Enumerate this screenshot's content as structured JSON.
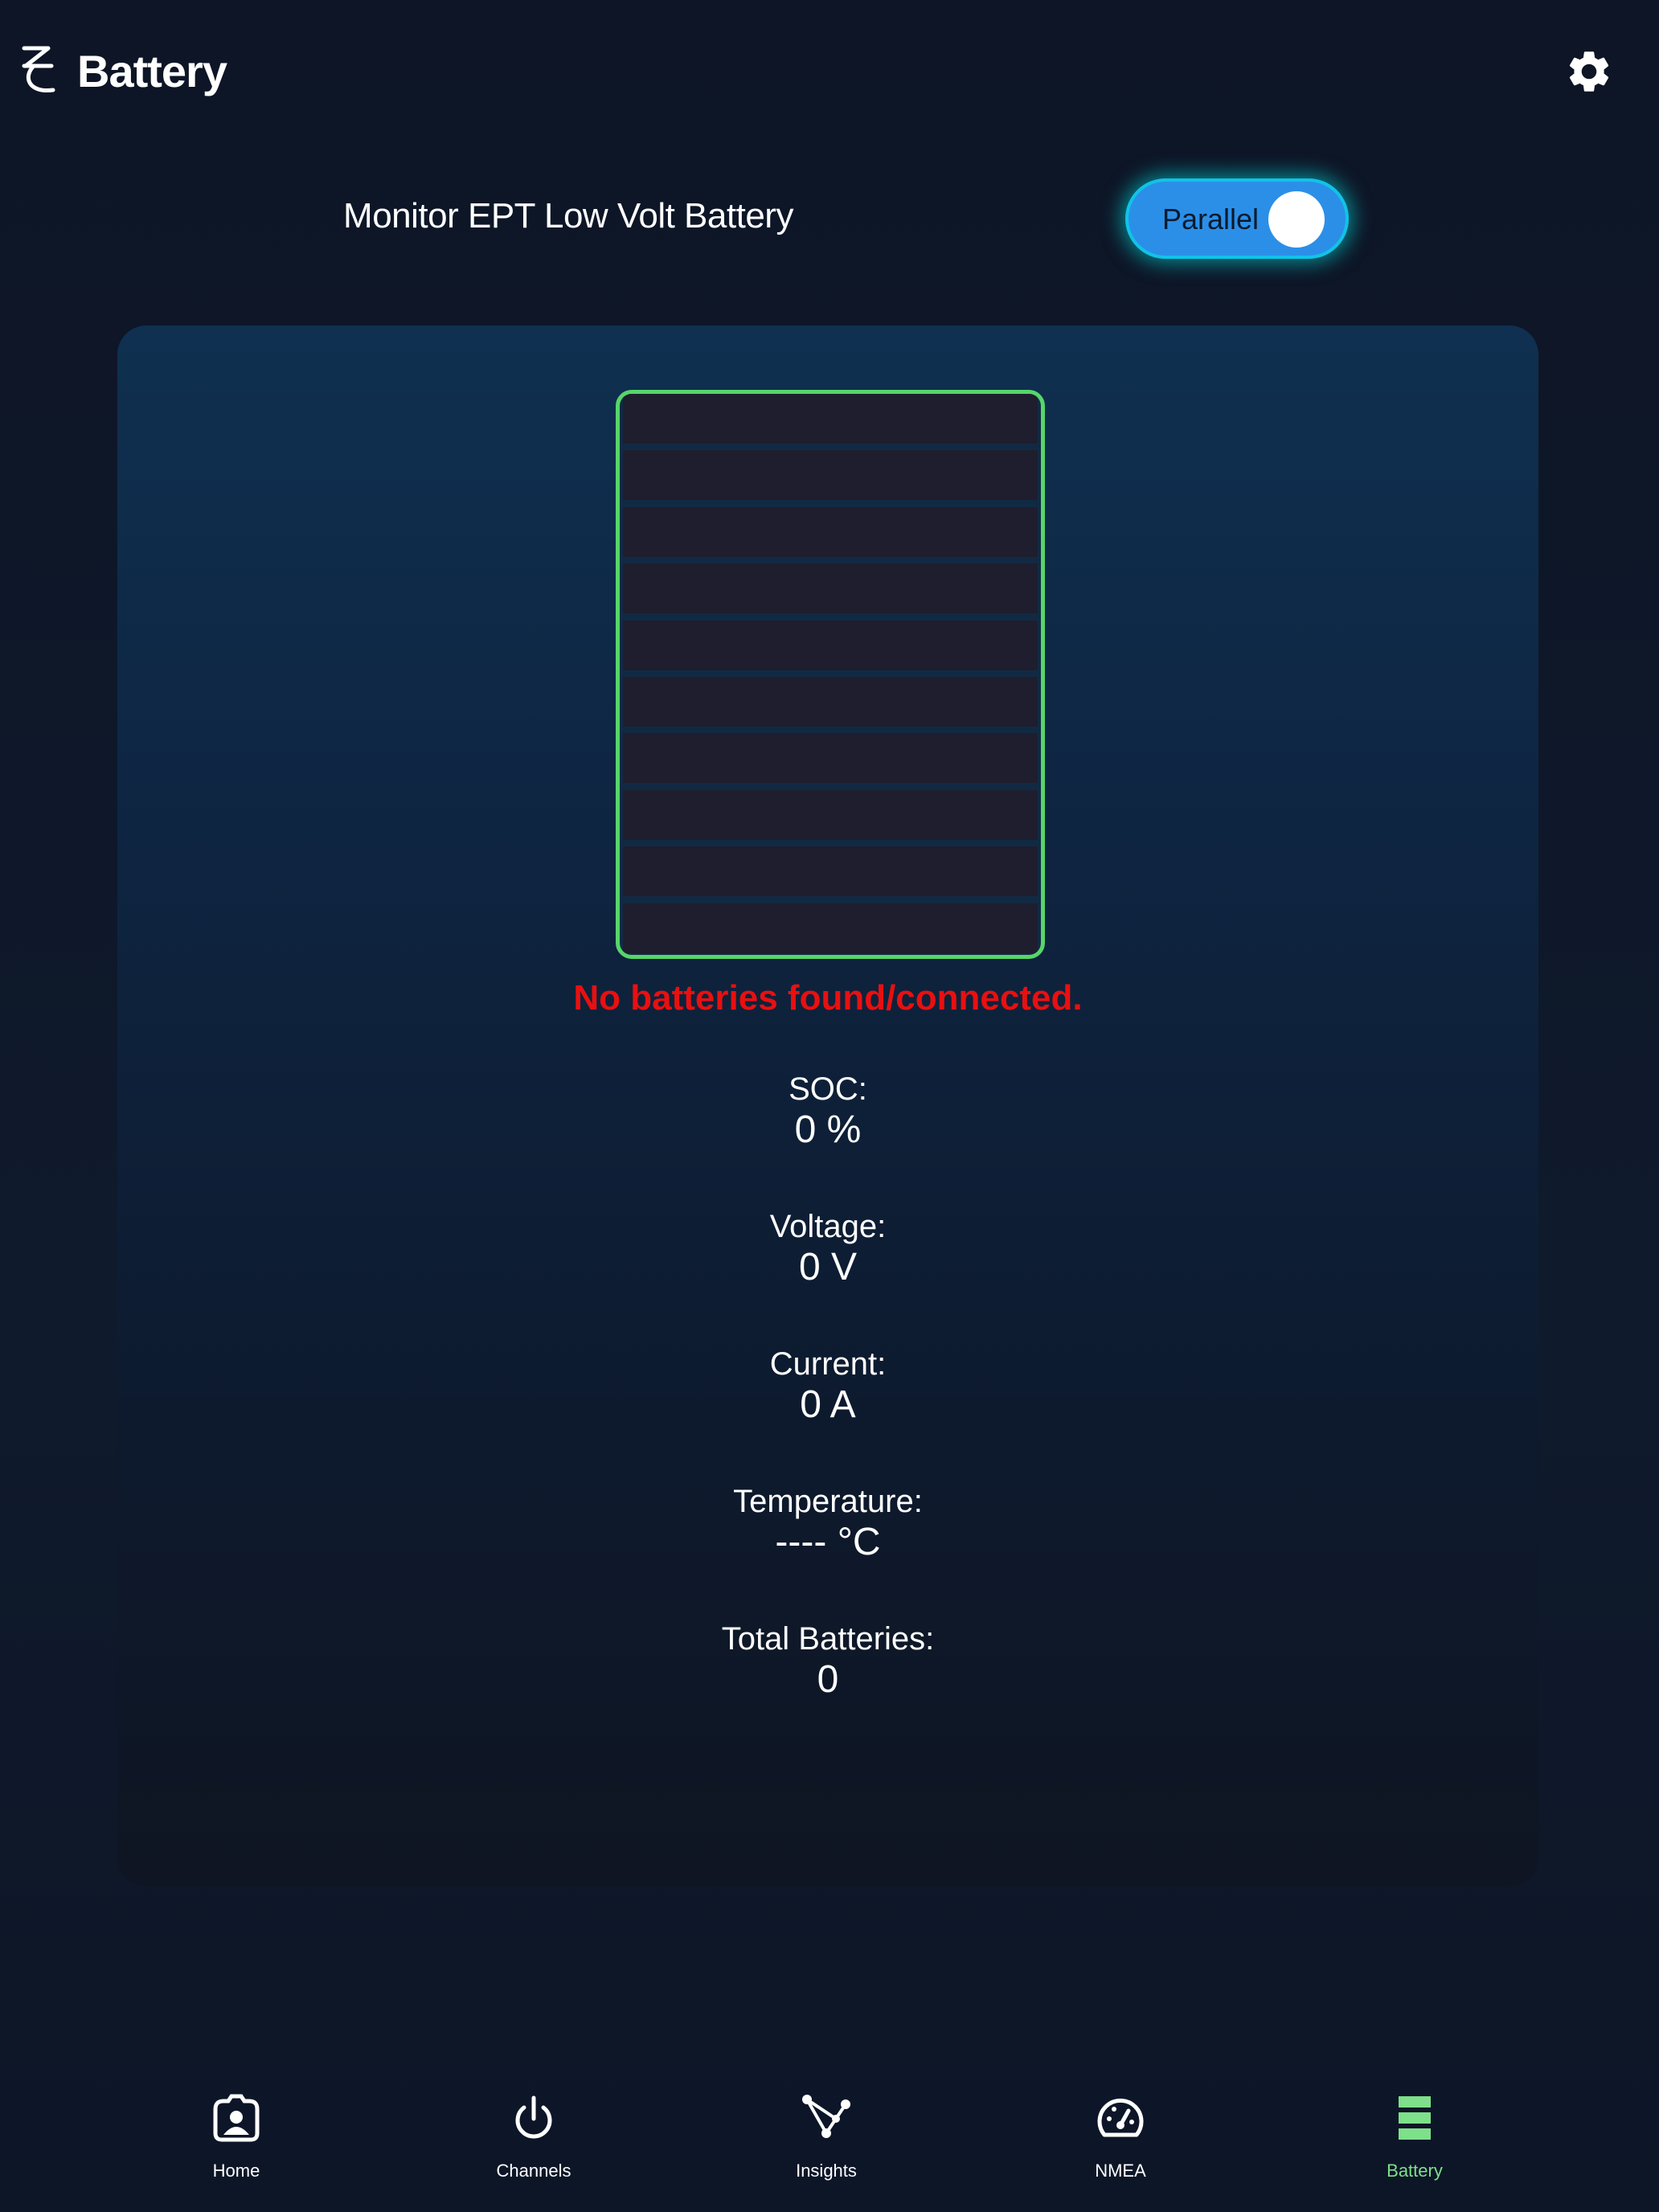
{
  "header": {
    "title": "Battery",
    "logo_icon": "logo-icon",
    "settings_icon": "gear-icon"
  },
  "monitor": {
    "label": "Monitor EPT Low Volt Battery",
    "toggle_label": "Parallel",
    "toggle_on": true
  },
  "battery": {
    "soc_level": 0,
    "status_message": "No batteries found/connected."
  },
  "stats": [
    {
      "label": "SOC:",
      "value": "0 %"
    },
    {
      "label": "Voltage:",
      "value": "0 V"
    },
    {
      "label": "Current:",
      "value": "0 A"
    },
    {
      "label": "Temperature:",
      "value": "---- °C"
    },
    {
      "label": "Total Batteries:",
      "value": "0"
    }
  ],
  "nav": [
    {
      "label": "Home",
      "icon": "home-icon"
    },
    {
      "label": "Channels",
      "icon": "power-icon"
    },
    {
      "label": "Insights",
      "icon": "insights-icon"
    },
    {
      "label": "NMEA",
      "icon": "gauge-icon"
    },
    {
      "label": "Battery",
      "icon": "battery-icon",
      "active": true
    }
  ],
  "colors": {
    "accent_green": "#56d66a",
    "error_red": "#e81010",
    "toggle_blue": "#2b8fe8",
    "toggle_glow": "#00dcdc",
    "active_nav": "#7ee08a"
  }
}
